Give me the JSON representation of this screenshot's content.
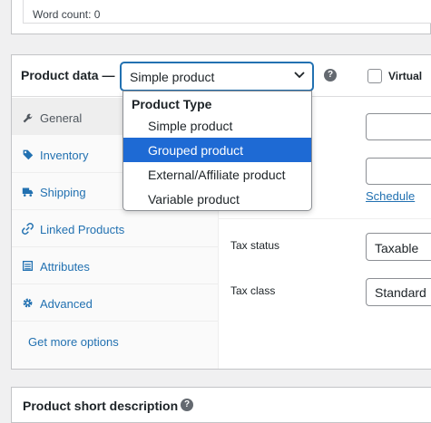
{
  "editor": {
    "word_count": "Word count: 0"
  },
  "product_data": {
    "title": "Product data —",
    "selected_type": "Simple product",
    "virtual_label": "Virtual",
    "help_glyph": "?",
    "dropdown": {
      "group_label": "Product Type",
      "options": [
        "Simple product",
        "Grouped product",
        "External/Affiliate product",
        "Variable product"
      ],
      "highlighted": "Grouped product"
    },
    "tabs": [
      {
        "label": "General",
        "icon": "wrench-icon"
      },
      {
        "label": "Inventory",
        "icon": "tag-icon"
      },
      {
        "label": "Shipping",
        "icon": "truck-icon"
      },
      {
        "label": "Linked Products",
        "icon": "link-icon"
      },
      {
        "label": "Attributes",
        "icon": "list-icon"
      },
      {
        "label": "Advanced",
        "icon": "gear-icon"
      }
    ],
    "more_options": "Get more options",
    "schedule_link": "Schedule",
    "tax_status": {
      "label": "Tax status",
      "value": "Taxable"
    },
    "tax_class": {
      "label": "Tax class",
      "value": "Standard"
    }
  },
  "short_description": {
    "title": "Product short description"
  },
  "colors": {
    "accent": "#2271b1",
    "highlight": "#1e6ad4"
  }
}
